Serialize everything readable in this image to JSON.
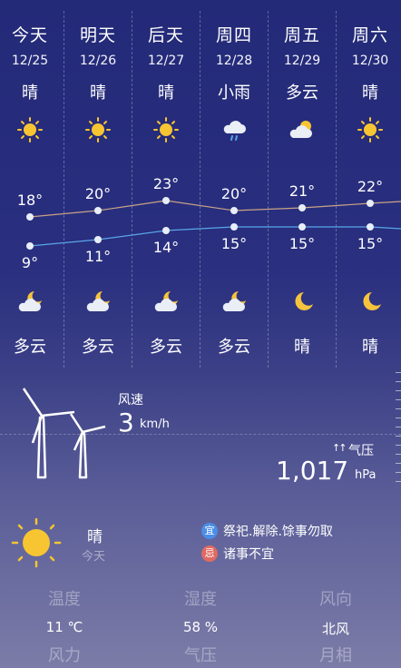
{
  "forecast": [
    {
      "day": "今天",
      "date": "12/25",
      "cond_day": "晴",
      "icon_day": "sun-icon",
      "high": "18°",
      "low": "9°",
      "icon_night": "cloudy-moon-icon",
      "cond_night": "多云"
    },
    {
      "day": "明天",
      "date": "12/26",
      "cond_day": "晴",
      "icon_day": "sun-icon",
      "high": "20°",
      "low": "11°",
      "icon_night": "cloudy-moon-icon",
      "cond_night": "多云"
    },
    {
      "day": "后天",
      "date": "12/27",
      "cond_day": "晴",
      "icon_day": "sun-icon",
      "high": "23°",
      "low": "14°",
      "icon_night": "cloudy-moon-icon",
      "cond_night": "多云"
    },
    {
      "day": "周四",
      "date": "12/28",
      "cond_day": "小雨",
      "icon_day": "rain-cloud-icon",
      "high": "20°",
      "low": "15°",
      "icon_night": "cloudy-moon-icon",
      "cond_night": "多云"
    },
    {
      "day": "周五",
      "date": "12/29",
      "cond_day": "多云",
      "icon_day": "partly-cloudy-icon",
      "high": "21°",
      "low": "15°",
      "icon_night": "moon-icon",
      "cond_night": "晴"
    },
    {
      "day": "周六",
      "date": "12/30",
      "cond_day": "晴",
      "icon_day": "sun-icon",
      "high": "22°",
      "low": "15°",
      "icon_night": "moon-icon",
      "cond_night": "晴"
    }
  ],
  "wind": {
    "label": "风速",
    "value": "3",
    "unit": "km/h"
  },
  "pressure": {
    "label": "气压",
    "value": "1,017",
    "unit": "hPa"
  },
  "today": {
    "condition": "晴",
    "day": "今天",
    "almanac": [
      {
        "badge": "宜",
        "text": "祭祀.解除.馀事勿取"
      },
      {
        "badge": "忌",
        "text": "诸事不宜"
      }
    ],
    "grid_labels_row1": [
      "温度",
      "湿度",
      "风向"
    ],
    "grid_values": [
      "11 ℃",
      "58 %",
      "北风"
    ],
    "grid_labels_row2": [
      "风力",
      "气压",
      "月相"
    ]
  },
  "colors": {
    "sun": "#f7c531",
    "high_line": "#c9a386",
    "low_line": "#5aa6ea",
    "cloud": "#e9eef7",
    "moon": "#f6c43c",
    "yi": "#4a8ee8",
    "ji": "#e06a62"
  }
}
